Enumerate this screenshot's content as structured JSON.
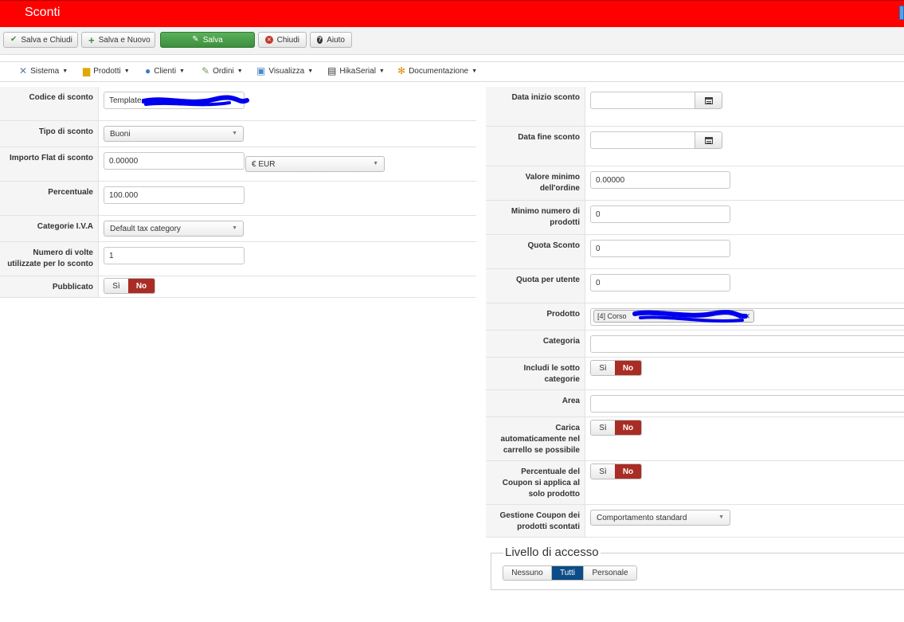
{
  "window": {
    "title": "Sconti"
  },
  "toolbar": {
    "save_close": "Salva e Chiudi",
    "save_new": "Salva e Nuovo",
    "save": "Salva",
    "close": "Chiudi",
    "help": "Aiuto"
  },
  "menu": {
    "items": [
      {
        "label": "Sistema",
        "icon": "wrench-icon"
      },
      {
        "label": "Prodotti",
        "icon": "box-icon"
      },
      {
        "label": "Clienti",
        "icon": "users-icon"
      },
      {
        "label": "Ordini",
        "icon": "orders-icon"
      },
      {
        "label": "Visualizza",
        "icon": "display-icon"
      },
      {
        "label": "HikaSerial",
        "icon": "serial-icon"
      },
      {
        "label": "Documentazione",
        "icon": "help-icon"
      }
    ]
  },
  "left_form": {
    "codice_label": "Codice di sconto",
    "codice_value": "Template",
    "tipo_label": "Tipo di sconto",
    "tipo_value": "Buoni",
    "importo_label": "Importo Flat di sconto",
    "importo_value": "0.00000",
    "currency_value": "€ EUR",
    "percentuale_label": "Percentuale",
    "percentuale_value": "100.000",
    "categorie_iva_label": "Categorie I.V.A",
    "categorie_iva_value": "Default tax category",
    "numero_volte_label": "Numero di volte utilizzate per lo sconto",
    "numero_volte_value": "1",
    "pubblicato_label": "Pubblicato"
  },
  "toggle": {
    "yes": "Sì",
    "no": "No"
  },
  "right_form": {
    "data_inizio_label": "Data inizio sconto",
    "data_fine_label": "Data fine sconto",
    "valore_minimo_label": "Valore minimo dell'ordine",
    "valore_minimo_value": "0.00000",
    "minimo_prodotti_label": "Minimo numero di prodotti",
    "minimo_prodotti_value": "0",
    "quota_sconto_label": "Quota Sconto",
    "quota_sconto_value": "0",
    "quota_utente_label": "Quota per utente",
    "quota_utente_value": "0",
    "prodotto_label": "Prodotto",
    "prodotto_tag": "[4] Corso",
    "prodotto_tag_suffix": "e",
    "categoria_label": "Categoria",
    "includi_label": "Includi le sotto categorie",
    "area_label": "Area",
    "carica_label": "Carica automaticamente nel carrello se possibile",
    "percentuale_coupon_label": "Percentuale del Coupon si applica al solo prodotto",
    "gestione_label": "Gestione Coupon dei prodotti scontati",
    "gestione_value": "Comportamento standard"
  },
  "access": {
    "legend": "Livello di accesso",
    "options": [
      "Nessuno",
      "Tutti",
      "Personale"
    ],
    "selected": "Tutti"
  },
  "colors": {
    "header": "#ff0000",
    "no_active": "#a92d24",
    "access_active": "#0d4c86",
    "save_green": "#3c8e3c",
    "redaction": "#0000ee"
  }
}
